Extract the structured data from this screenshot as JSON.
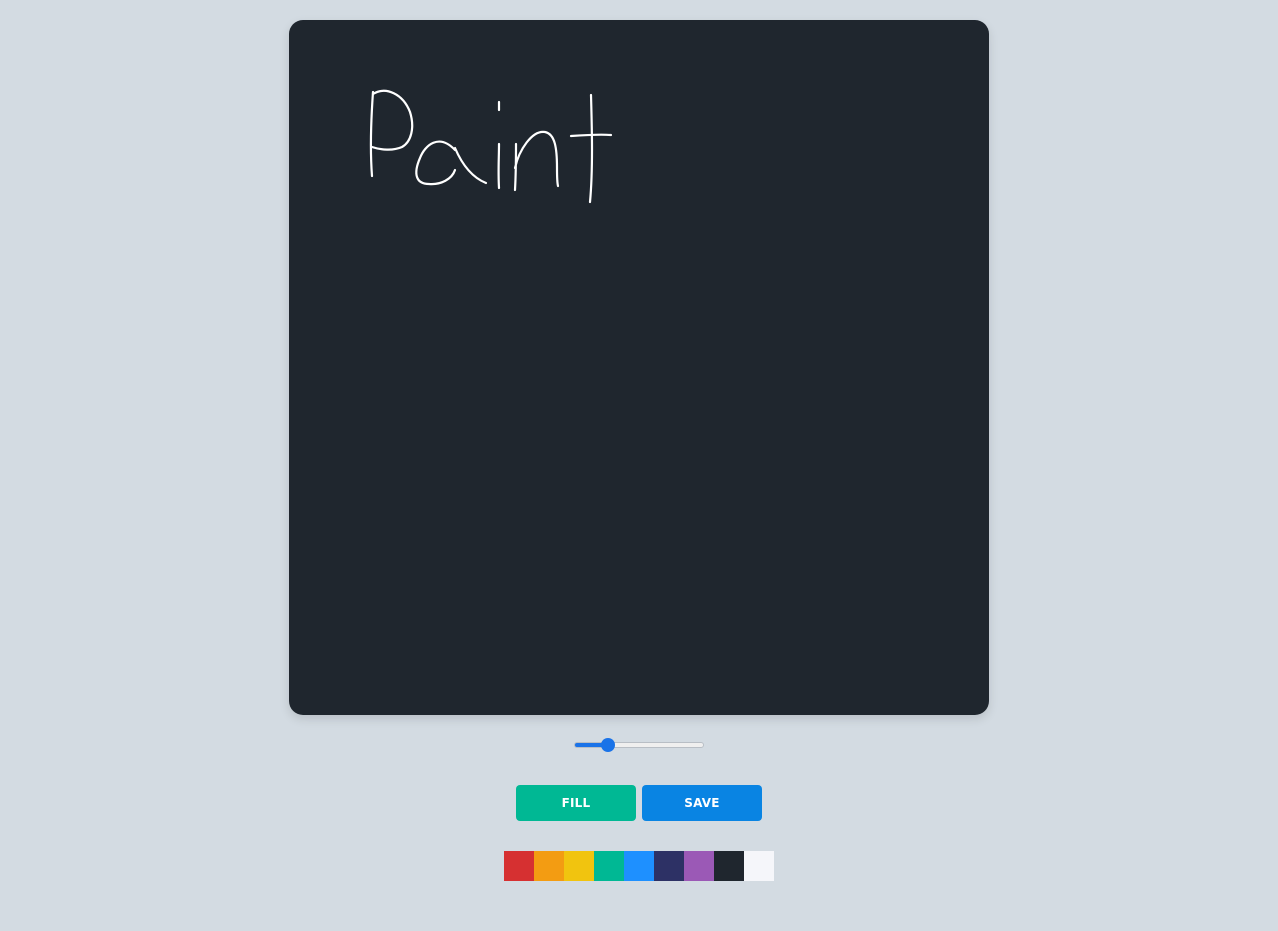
{
  "canvas": {
    "background": "#1f262e",
    "stroke_color": "#ffffff",
    "drawn_text": "Paint"
  },
  "brush_size": {
    "value": 10,
    "min": 1,
    "max": 40,
    "accent": "#1a73e8"
  },
  "buttons": {
    "fill_label": "FILL",
    "fill_color": "#00b894",
    "save_label": "SAVE",
    "save_color": "#0984e3"
  },
  "palette": [
    {
      "name": "red",
      "color": "#d63031"
    },
    {
      "name": "orange",
      "color": "#f39c12"
    },
    {
      "name": "yellow",
      "color": "#f1c40f"
    },
    {
      "name": "teal",
      "color": "#00b894"
    },
    {
      "name": "blue",
      "color": "#1e90ff"
    },
    {
      "name": "navy",
      "color": "#2d3165"
    },
    {
      "name": "purple",
      "color": "#9b59b6"
    },
    {
      "name": "dark",
      "color": "#1f262e"
    },
    {
      "name": "white",
      "color": "#f5f6fa"
    }
  ]
}
